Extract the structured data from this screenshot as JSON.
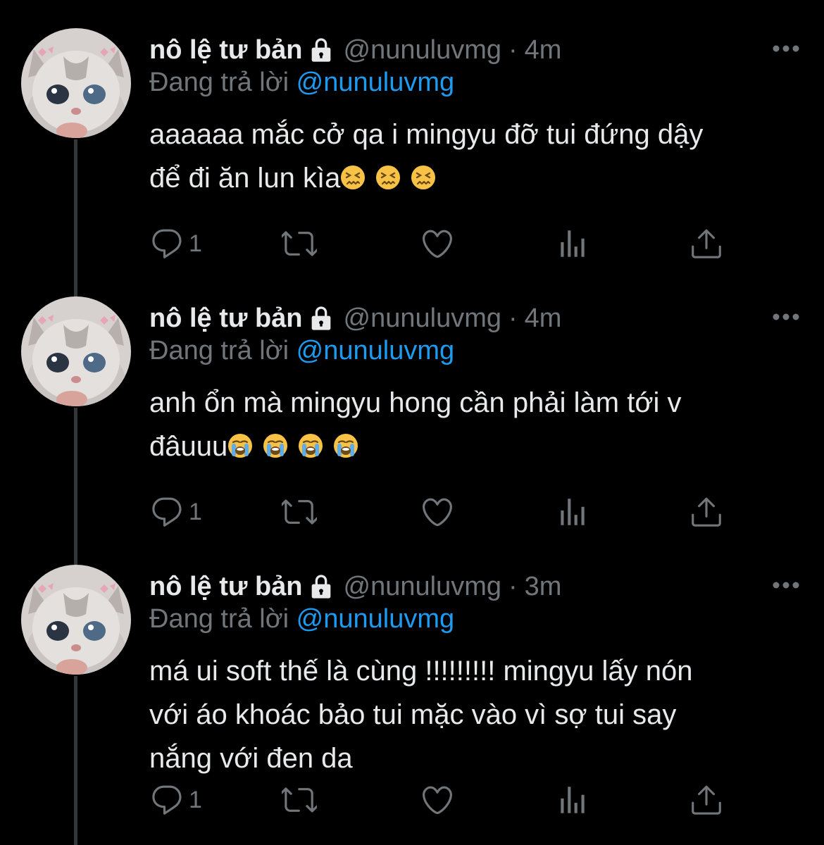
{
  "colors": {
    "background": "#000000",
    "text": "#e7e9ea",
    "secondary": "#71767b",
    "mention": "#1d9bf0",
    "thread_line": "#333639"
  },
  "tweets": [
    {
      "display_name": "nô lệ tư bản",
      "handle": "@nunuluvmg",
      "dot": "·",
      "time": "4m",
      "reply_prefix": "Đang trả lời",
      "reply_to": "@nunuluvmg",
      "text_lines": [
        "aaaaaa mắc cở qa i mingyu đỡ tui đứng dậy",
        "để đi ăn lun kìa"
      ],
      "emoji": [
        "confounded-face",
        "confounded-face",
        "confounded-face"
      ],
      "reply_count": "1",
      "icons": [
        "lock-icon",
        "more-icon",
        "reply-icon",
        "retweet-icon",
        "like-icon",
        "views-icon",
        "share-icon"
      ]
    },
    {
      "display_name": "nô lệ tư bản",
      "handle": "@nunuluvmg",
      "dot": "·",
      "time": "4m",
      "reply_prefix": "Đang trả lời",
      "reply_to": "@nunuluvmg",
      "text_lines": [
        "anh ổn mà mingyu hong cần phải làm tới v",
        "đâuuu"
      ],
      "emoji": [
        "loudly-crying-face",
        "loudly-crying-face",
        "loudly-crying-face",
        "loudly-crying-face"
      ],
      "reply_count": "1"
    },
    {
      "display_name": "nô lệ tư bản",
      "handle": "@nunuluvmg",
      "dot": "·",
      "time": "3m",
      "reply_prefix": "Đang trả lời",
      "reply_to": "@nunuluvmg",
      "text_lines": [
        "má ui soft thế là cùng !!!!!!!!! mingyu lấy nón",
        "với áo khoác bảo tui mặc vào vì sợ tui say",
        "nắng với đen da"
      ],
      "emoji": [],
      "reply_count": "1"
    }
  ]
}
